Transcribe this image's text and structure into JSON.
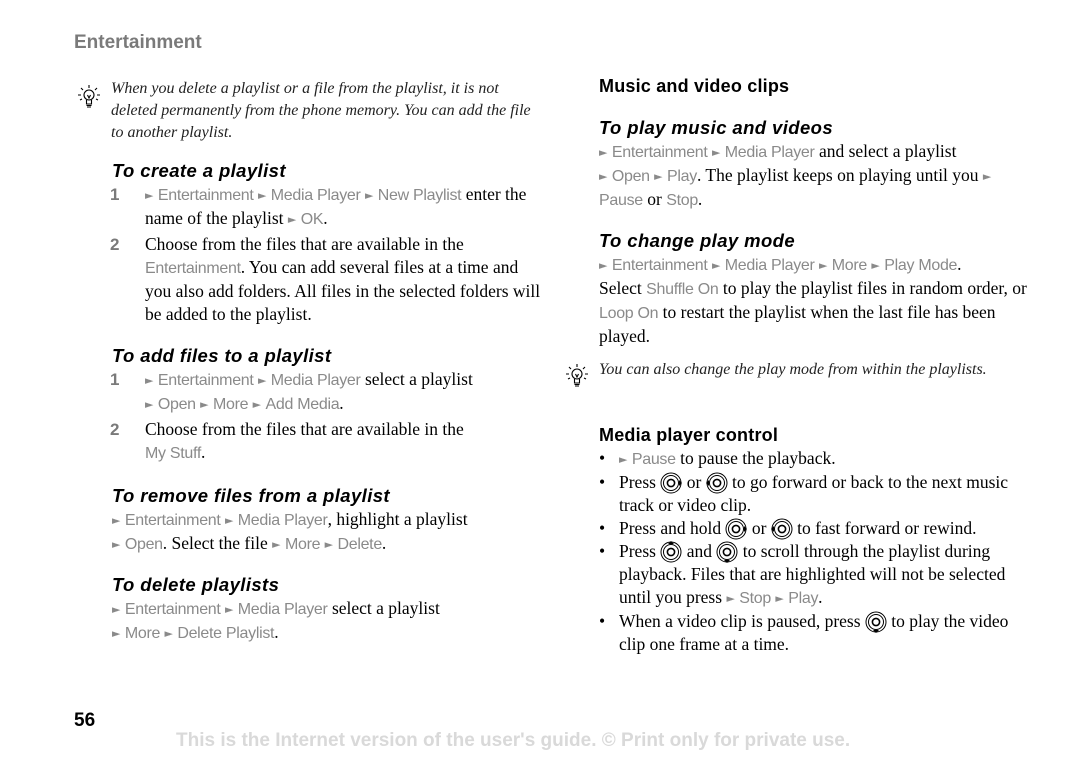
{
  "section_header": "Entertainment",
  "left": {
    "tip": "When you delete a playlist or a file from the playlist, it is not deleted permanently from the phone memory. You can add the file to another playlist.",
    "create": {
      "heading": "To create a playlist",
      "step1_num": "1",
      "step1_menu": [
        "Entertainment",
        "Media Player",
        "New Playlist"
      ],
      "step1_text": "enter the name of the playlist",
      "step1_menu2": "OK",
      "step2_num": "2",
      "step2_text_a": "Choose from the files that are available in the",
      "step2_menu": "Entertainment",
      "step2_text_b": ". You can add several files at a time and you also add folders. All files in the selected folders will be added to the playlist."
    },
    "add": {
      "heading": "To add files to a playlist",
      "step1_num": "1",
      "step1_menu": [
        "Entertainment",
        "Media Player"
      ],
      "step1_text": "select a playlist",
      "step1_menu2": [
        "Open",
        "More",
        "Add Media"
      ],
      "step2_num": "2",
      "step2_text": "Choose from the files that are available in the",
      "step2_menu": "My Stuff"
    },
    "remove": {
      "heading": "To remove files from a playlist",
      "menu": [
        "Entertainment",
        "Media Player"
      ],
      "text1": ", highlight a playlist",
      "menu2": "Open",
      "text2": ". Select the file",
      "menu3": [
        "More",
        "Delete"
      ]
    },
    "delete": {
      "heading": "To delete playlists",
      "menu": [
        "Entertainment",
        "Media Player"
      ],
      "text": "select a playlist",
      "menu2": [
        "More",
        "Delete Playlist"
      ]
    }
  },
  "right": {
    "title": "Music and video clips",
    "play": {
      "heading": "To play music and videos",
      "menu": [
        "Entertainment",
        "Media Player"
      ],
      "text1": "and select a playlist",
      "menu2": [
        "Open",
        "Play"
      ],
      "text2": ". The playlist keeps on playing until you",
      "menu3": "Pause",
      "text3": "or",
      "menu4": "Stop"
    },
    "mode": {
      "heading": "To change play mode",
      "menu": [
        "Entertainment",
        "Media Player",
        "More",
        "Play Mode"
      ],
      "text1": "Select",
      "opt1": "Shuffle On",
      "text2": "to play the playlist files in random order, or",
      "opt2": "Loop On",
      "text3": "to restart the playlist when the last file has been played."
    },
    "tip": "You can also change the play mode from within the playlists.",
    "control": {
      "heading": "Media player control",
      "b1_menu": "Pause",
      "b1_text": "to pause the playback.",
      "b2_a": "Press",
      "b2_b": "or",
      "b2_c": "to go forward or back to the next music track or video clip.",
      "b3_a": "Press and hold",
      "b3_b": "or",
      "b3_c": "to fast forward or rewind.",
      "b4_a": "Press",
      "b4_b": "and",
      "b4_c": "to scroll through the playlist during playback. Files that are highlighted will not be selected until you press",
      "b4_menu": [
        "Stop",
        "Play"
      ],
      "b5_a": "When a video clip is paused, press",
      "b5_b": "to play the video clip one frame at a time."
    }
  },
  "footer": {
    "page_number": "56",
    "notice": "This is the Internet version of the user's guide. © Print only for private use."
  },
  "icons": {
    "arrow": "►",
    "bullet": "•"
  },
  "colors": {
    "menu_gray": "#8a8a8a",
    "header_gray": "#7a7a7a",
    "footer_gray": "#d9d9d9"
  }
}
